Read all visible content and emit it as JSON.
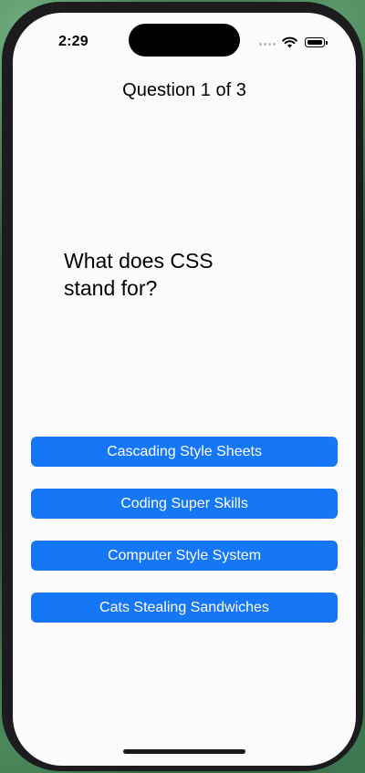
{
  "status_bar": {
    "time": "2:29"
  },
  "header": {
    "title": "Question 1 of 3"
  },
  "question": {
    "text": "What does CSS stand for?"
  },
  "answers": [
    {
      "label": "Cascading Style Sheets"
    },
    {
      "label": "Coding Super Skills"
    },
    {
      "label": "Computer Style System"
    },
    {
      "label": "Cats Stealing Sandwiches"
    }
  ],
  "colors": {
    "accent": "#1677f6",
    "background": "#fbfbfd",
    "text": "#000000"
  },
  "icons": [
    "signal-dots-icon",
    "wifi-icon",
    "battery-icon"
  ]
}
